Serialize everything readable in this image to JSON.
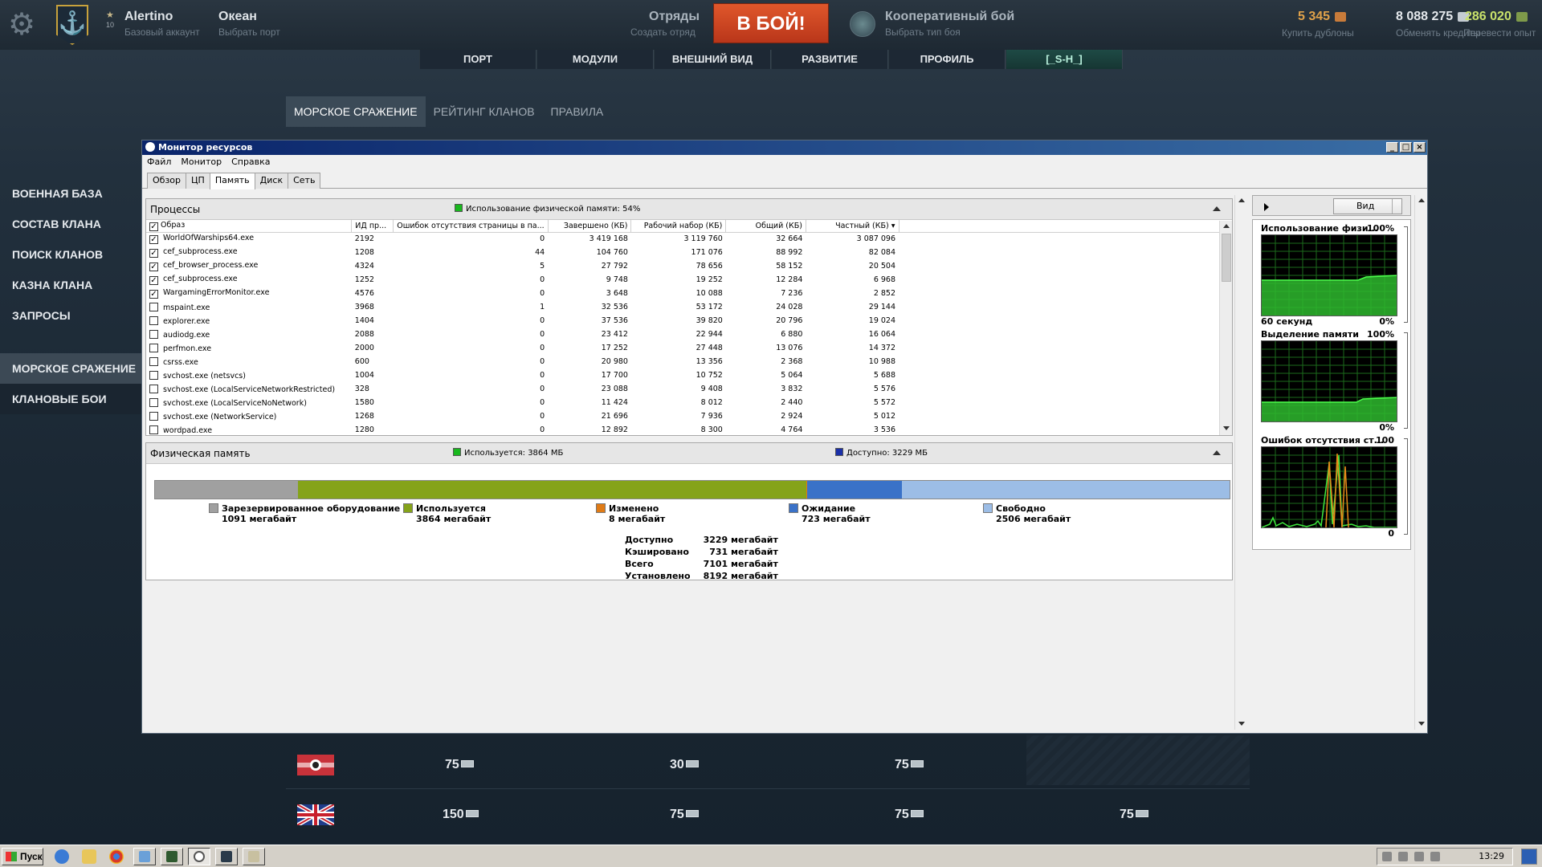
{
  "topbar": {
    "account_name": "Alertino",
    "account_sub": "Базовый аккаунт",
    "level": "10",
    "port_name": "Океан",
    "port_sub": "Выбрать порт",
    "squads_name": "Отряды",
    "squads_sub": "Создать отряд",
    "battle_button": "В БОЙ!",
    "mode_name": "Кооперативный бой",
    "mode_sub": "Выбрать тип боя",
    "doubloons": "5 345",
    "doubloons_sub": "Купить дублоны",
    "credits": "8 088 275",
    "credits_sub": "Обменять кредиты",
    "free_xp": "286 020",
    "free_xp_sub": "Перевести опыт"
  },
  "main_nav": [
    "ПОРТ",
    "МОДУЛИ",
    "ВНЕШНИЙ ВИД",
    "РАЗВИТИЕ",
    "ПРОФИЛЬ",
    "[_S-H_]"
  ],
  "sub_nav": [
    "МОРСКОЕ СРАЖЕНИЕ",
    "РЕЙТИНГ КЛАНОВ",
    "ПРАВИЛА"
  ],
  "left_menu": {
    "group1": [
      "ВОЕННАЯ БАЗА",
      "СОСТАВ КЛАНА",
      "ПОИСК КЛАНОВ",
      "КАЗНА КЛАНА",
      "ЗАПРОСЫ"
    ],
    "group2": [
      "МОРСКОЕ СРАЖЕНИЕ",
      "КЛАНОВЫЕ БОИ"
    ]
  },
  "resmon": {
    "title": "Монитор ресурсов",
    "menu": [
      "Файл",
      "Монитор",
      "Справка"
    ],
    "tabs": [
      "Обзор",
      "ЦП",
      "Память",
      "Диск",
      "Сеть"
    ],
    "processes": {
      "title": "Процессы",
      "usage_label": "Использование физической памяти: 54%",
      "columns": [
        "Образ",
        "ИД пр...",
        "Ошибок отсутствия страницы в па...",
        "Завершено (КБ)",
        "Рабочий набор (КБ)",
        "Общий (КБ)",
        "Частный (КБ)"
      ],
      "rows": [
        {
          "checked": true,
          "name": "WorldOfWarships64.exe",
          "pid": "2192",
          "faults": "0",
          "commit": "3 419 168",
          "ws": "3 119 760",
          "shared": "32 664",
          "private": "3 087 096"
        },
        {
          "checked": true,
          "name": "cef_subprocess.exe",
          "pid": "1208",
          "faults": "44",
          "commit": "104 760",
          "ws": "171 076",
          "shared": "88 992",
          "private": "82 084"
        },
        {
          "checked": true,
          "name": "cef_browser_process.exe",
          "pid": "4324",
          "faults": "5",
          "commit": "27 792",
          "ws": "78 656",
          "shared": "58 152",
          "private": "20 504"
        },
        {
          "checked": true,
          "name": "cef_subprocess.exe",
          "pid": "1252",
          "faults": "0",
          "commit": "9 748",
          "ws": "19 252",
          "shared": "12 284",
          "private": "6 968"
        },
        {
          "checked": true,
          "name": "WargamingErrorMonitor.exe",
          "pid": "4576",
          "faults": "0",
          "commit": "3 648",
          "ws": "10 088",
          "shared": "7 236",
          "private": "2 852"
        },
        {
          "checked": false,
          "name": "mspaint.exe",
          "pid": "3968",
          "faults": "1",
          "commit": "32 536",
          "ws": "53 172",
          "shared": "24 028",
          "private": "29 144"
        },
        {
          "checked": false,
          "name": "explorer.exe",
          "pid": "1404",
          "faults": "0",
          "commit": "37 536",
          "ws": "39 820",
          "shared": "20 796",
          "private": "19 024"
        },
        {
          "checked": false,
          "name": "audiodg.exe",
          "pid": "2088",
          "faults": "0",
          "commit": "23 412",
          "ws": "22 944",
          "shared": "6 880",
          "private": "16 064"
        },
        {
          "checked": false,
          "name": "perfmon.exe",
          "pid": "2000",
          "faults": "0",
          "commit": "17 252",
          "ws": "27 448",
          "shared": "13 076",
          "private": "14 372"
        },
        {
          "checked": false,
          "name": "csrss.exe",
          "pid": "600",
          "faults": "0",
          "commit": "20 980",
          "ws": "13 356",
          "shared": "2 368",
          "private": "10 988"
        },
        {
          "checked": false,
          "name": "svchost.exe (netsvcs)",
          "pid": "1004",
          "faults": "0",
          "commit": "17 700",
          "ws": "10 752",
          "shared": "5 064",
          "private": "5 688"
        },
        {
          "checked": false,
          "name": "svchost.exe (LocalServiceNetworkRestricted)",
          "pid": "328",
          "faults": "0",
          "commit": "23 088",
          "ws": "9 408",
          "shared": "3 832",
          "private": "5 576"
        },
        {
          "checked": false,
          "name": "svchost.exe (LocalServiceNoNetwork)",
          "pid": "1580",
          "faults": "0",
          "commit": "11 424",
          "ws": "8 012",
          "shared": "2 440",
          "private": "5 572"
        },
        {
          "checked": false,
          "name": "svchost.exe (NetworkService)",
          "pid": "1268",
          "faults": "0",
          "commit": "21 696",
          "ws": "7 936",
          "shared": "2 924",
          "private": "5 012"
        },
        {
          "checked": false,
          "name": "wordpad.exe",
          "pid": "1280",
          "faults": "0",
          "commit": "12 892",
          "ws": "8 300",
          "shared": "4 764",
          "private": "3 536"
        }
      ]
    },
    "physical": {
      "title": "Физическая память",
      "used_label": "Используется: 3864 МБ",
      "avail_label": "Доступно: 3229 МБ",
      "legend": [
        {
          "label": "Зарезервированное оборудование",
          "value": "1091 мегабайт",
          "color": "#a0a0a0"
        },
        {
          "label": "Используется",
          "value": "3864 мегабайт",
          "color": "#85a31a"
        },
        {
          "label": "Изменено",
          "value": "8 мегабайт",
          "color": "#e07b16"
        },
        {
          "label": "Ожидание",
          "value": "723 мегабайт",
          "color": "#3a72c8"
        },
        {
          "label": "Свободно",
          "value": "2506 мегабайт",
          "color": "#9cbde6"
        }
      ],
      "bar_fractions": [
        0.1333,
        0.4726,
        0.001,
        0.0884,
        0.3047
      ],
      "summary": [
        {
          "label": "Доступно",
          "value": "3229 мегабайт"
        },
        {
          "label": "Кэшировано",
          "value": "731 мегабайт"
        },
        {
          "label": "Всего",
          "value": "7101 мегабайт"
        },
        {
          "label": "Установлено",
          "value": "8192 мегабайт"
        }
      ]
    },
    "right": {
      "view_button": "Вид",
      "g1_title": "Использование физи...",
      "g1_max": "100%",
      "g1_foot_left": "60 секунд",
      "g1_foot_right": "0%",
      "g2_title": "Выделение памяти",
      "g2_max": "100%",
      "g2_foot_right": "0%",
      "g3_title": "Ошибок отсутствия ст...",
      "g3_max": "100",
      "g3_foot_right": "0"
    }
  },
  "bottom_rows": [
    {
      "values": [
        "75",
        "30",
        "75",
        ""
      ]
    },
    {
      "values": [
        "150",
        "75",
        "75",
        "75"
      ]
    }
  ],
  "taskbar": {
    "start_label": "Пуск",
    "clock": "13:29"
  }
}
